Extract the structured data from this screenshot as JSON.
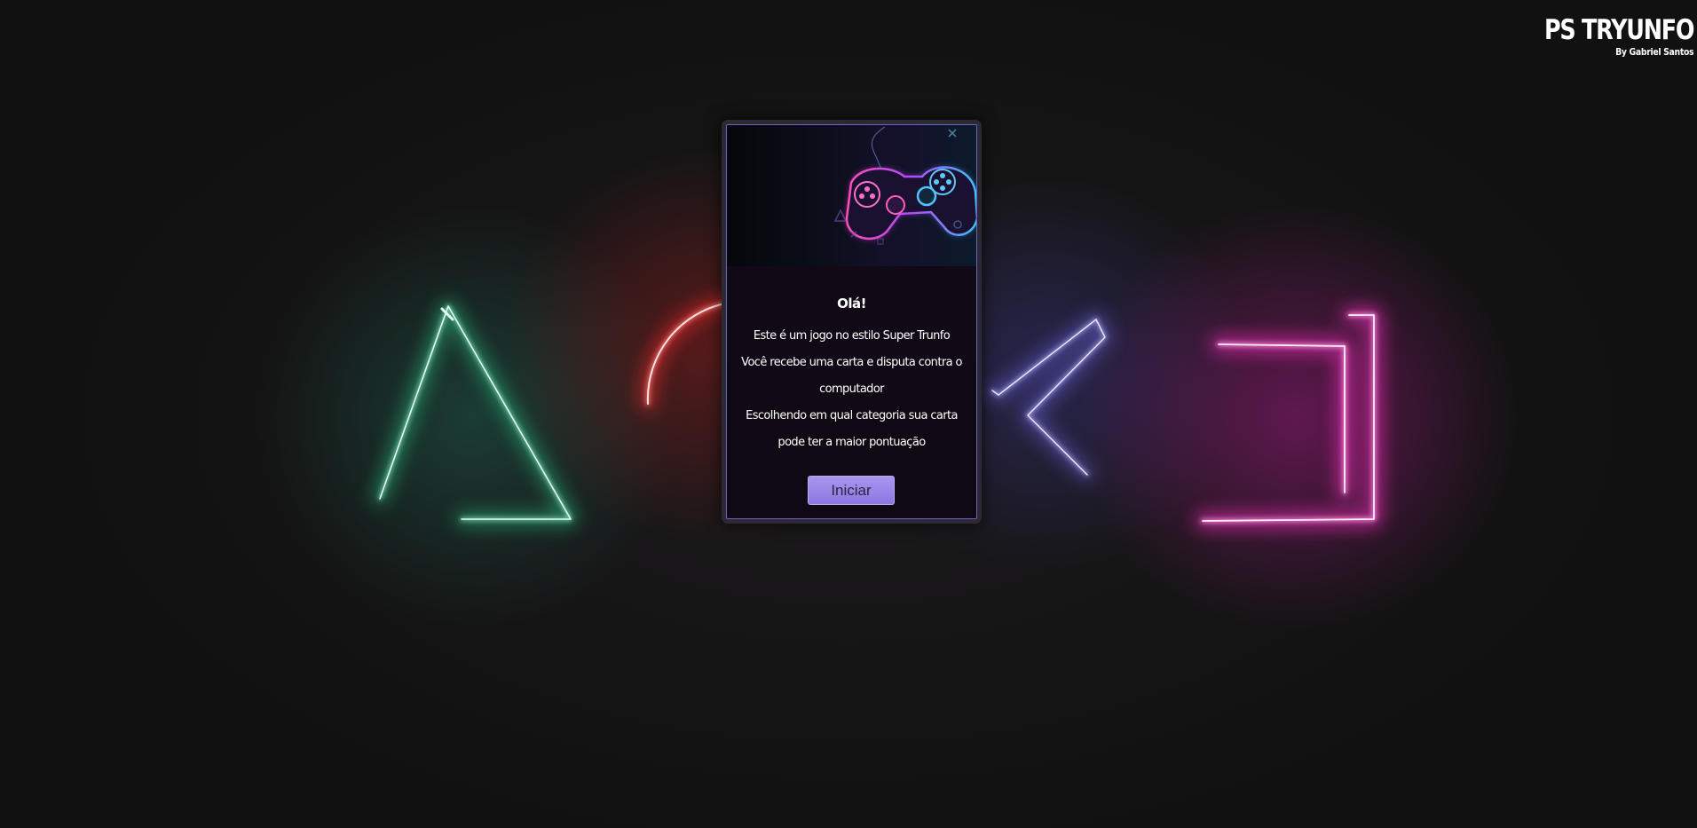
{
  "brand": {
    "title": "PS TRYUNFO",
    "subtitle": "By Gabriel Santos"
  },
  "background": {
    "icons": [
      "triangle-icon",
      "circle-icon",
      "cross-icon",
      "square-icon"
    ]
  },
  "welcome_card": {
    "image": "gamepad-illustration",
    "greeting": "Olá!",
    "lines": [
      "Este é um jogo no estilo Super Trunfo",
      "Você recebe uma carta e disputa contra o computador",
      "Escolhendo em qual categoria sua carta pode ter a maior pontuação"
    ],
    "start_label": "Iniciar"
  },
  "colors": {
    "triangle": "#3fd6a0",
    "circle": "#ff3b3b",
    "cross": "#8b84ff",
    "square": "#ff2fc4",
    "accent": "#8b78e3"
  }
}
